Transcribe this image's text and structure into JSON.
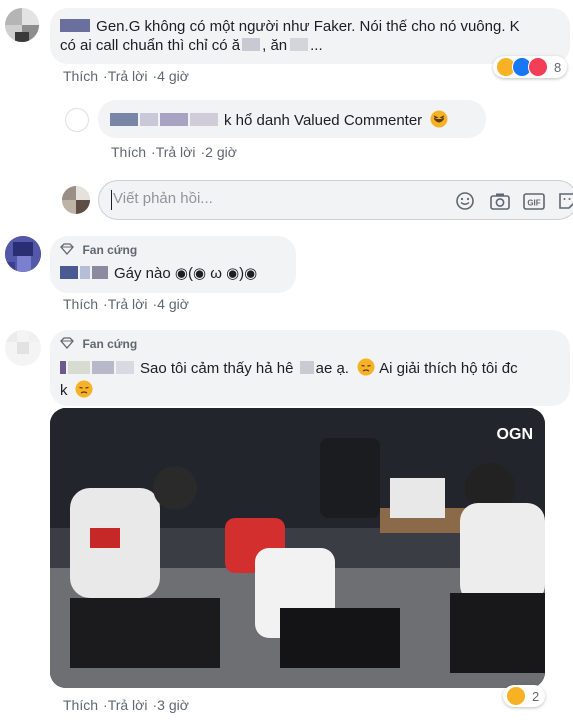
{
  "comment1": {
    "text_line1": "Gen.G không có một người như Faker. Nói thế cho nó vuông. K",
    "text_line2_prefix": "có ai call chuẩn thì chỉ có ă",
    "text_line2_mid": ", ăn",
    "text_line2_suffix": "...",
    "like_label": "Thích",
    "reply_label": "Trả lời",
    "time": "4 giờ",
    "reaction_count": "8"
  },
  "reply1": {
    "text": "k hổ danh Valued Commenter",
    "like_label": "Thích",
    "reply_label": "Trả lời",
    "time": "2 giờ"
  },
  "reply_box": {
    "placeholder": "Viết phản hồi..."
  },
  "comment2": {
    "badge": "Fan cứng",
    "text": "Gáy nào ◉(◉ ω ◉)◉",
    "like_label": "Thích",
    "reply_label": "Trả lời",
    "time": "4 giờ"
  },
  "comment3": {
    "badge": "Fan cứng",
    "text_part1": "Sao tôi cảm thấy hả hê",
    "text_part2": "ae ạ.",
    "text_part3": "Ai giải thích hộ tôi đc",
    "text_line2": "k",
    "image_watermark": "OGN",
    "like_label": "Thích",
    "reply_label": "Trả lời",
    "time": "3 giờ",
    "reaction_count": "2"
  },
  "colors": {
    "bubble": "#f2f3f5",
    "meta_text": "#616770",
    "like_blue": "#1877f2",
    "love_red": "#f33e58",
    "haha_yellow": "#f7b125"
  },
  "icons": [
    "diamond-icon",
    "smiley-icon",
    "camera-icon",
    "gif-icon",
    "sticker-icon",
    "haha-emoji",
    "like-emoji",
    "love-emoji",
    "sad-emoji"
  ]
}
